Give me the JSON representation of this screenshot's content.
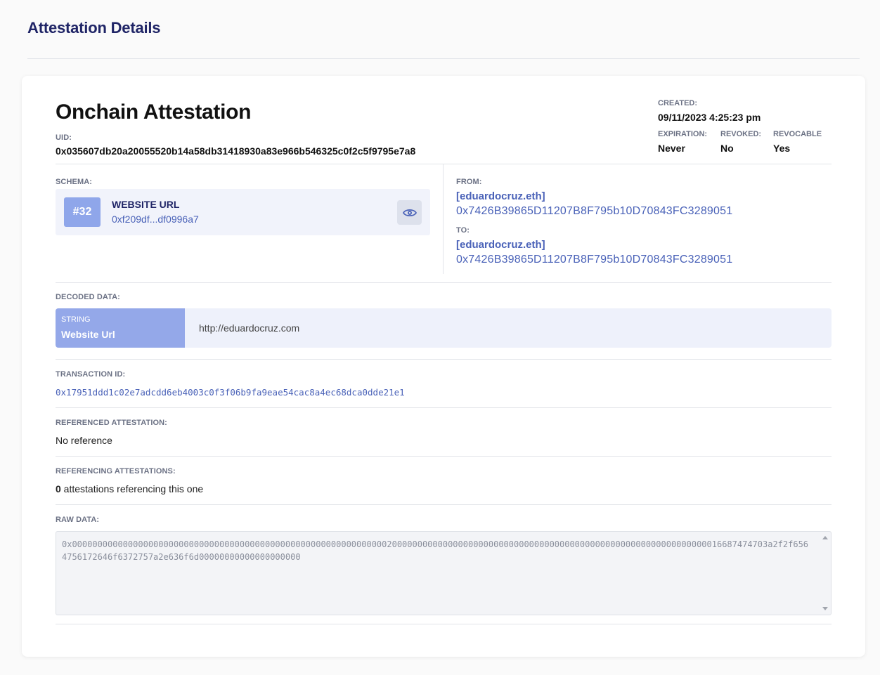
{
  "page": {
    "title": "Attestation Details"
  },
  "attestation": {
    "title": "Onchain Attestation",
    "uid_label": "UID:",
    "uid": "0x035607db20a20055520b14a58db31418930a83e966b546325c0f2c5f9795e7a8",
    "created_label": "CREATED:",
    "created": "09/11/2023 4:25:23 pm",
    "expiration_label": "EXPIRATION:",
    "expiration": "Never",
    "revoked_label": "REVOKED:",
    "revoked": "No",
    "revocable_label": "REVOCABLE",
    "revocable": "Yes"
  },
  "schema": {
    "label": "SCHEMA:",
    "number": "#32",
    "name": "WEBSITE URL",
    "uid_short": "0xf209df...df0996a7",
    "view_icon": "eye-icon"
  },
  "from": {
    "label": "FROM:",
    "name": "[eduardocruz.eth]",
    "address": "0x7426B39865D11207B8F795b10D70843FC3289051"
  },
  "to": {
    "label": "TO:",
    "name": "[eduardocruz.eth]",
    "address": "0x7426B39865D11207B8F795b10D70843FC3289051"
  },
  "decoded": {
    "label": "DECODED DATA:",
    "type": "STRING",
    "field_name": "Website Url",
    "value": "http://eduardocruz.com"
  },
  "transaction": {
    "label": "TRANSACTION ID:",
    "id": "0x17951ddd1c02e7adcdd6eb4003c0f3f06b9fa9eae54cac8a4ec68dca0dde21e1"
  },
  "referenced": {
    "label": "REFERENCED ATTESTATION:",
    "value": "No reference"
  },
  "referencing": {
    "label": "REFERENCING ATTESTATIONS:",
    "count": "0",
    "suffix": " attestations referencing this one"
  },
  "raw": {
    "label": "RAW DATA:",
    "value": "0x00000000000000000000000000000000000000000000000000000000000000200000000000000000000000000000000000000000000000000000000000000016687474703a2f2f6564756172646f6372757a2e636f6d00000000000000000000"
  },
  "colors": {
    "title": "#1f2466",
    "link": "#4a62b8",
    "badge": "#8fa6ea",
    "decoded_bg": "#eef1fb"
  }
}
